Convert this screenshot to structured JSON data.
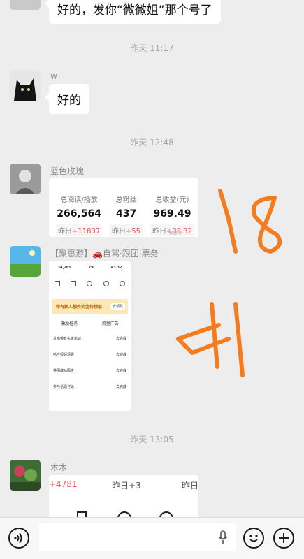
{
  "messages": {
    "m0_text": "好的，发你“微微姐”那个号了",
    "ts1": "昨天 11:17",
    "m1_sender": "w",
    "m1_text": "好的",
    "ts2": "昨天 12:48",
    "m2_sender": "蓝色玫瑰",
    "m3_sender": "【聚惠游】🚗自驾·跟团·票务",
    "ts3": "昨天 13:05",
    "m4_sender": "木木"
  },
  "stats_card": {
    "items": [
      {
        "label": "总阅读/播放",
        "value": "266,564",
        "change_prefix": "昨日",
        "change": "+11837"
      },
      {
        "label": "总粉丝",
        "value": "437",
        "change_prefix": "昨日",
        "change": "+55"
      },
      {
        "label": "总收益(元)",
        "value": "969.49",
        "change_prefix": "昨日",
        "change": "+38.32"
      }
    ],
    "footnote": "更新中"
  },
  "mini_screenshot": {
    "stats": [
      "34,265",
      "79",
      "43.32"
    ],
    "banner": "你有新人额外奖金待领取",
    "banner_btn": "去领取",
    "tab1": "激励任务",
    "tab2": "流量广告",
    "tasks": [
      "发布带有头条笔记",
      "响应视频观看",
      "带图成功图文",
      "参与话题讨论"
    ],
    "task_btn": "去完成"
  },
  "partial_card": {
    "left_value": "+4781",
    "middle": "昨日+3",
    "right": "昨日"
  },
  "handwriting": {
    "top": "18",
    "bottom": "41"
  },
  "colors": {
    "accent_up": "#ef5350",
    "handwriting": "#f47c20"
  }
}
